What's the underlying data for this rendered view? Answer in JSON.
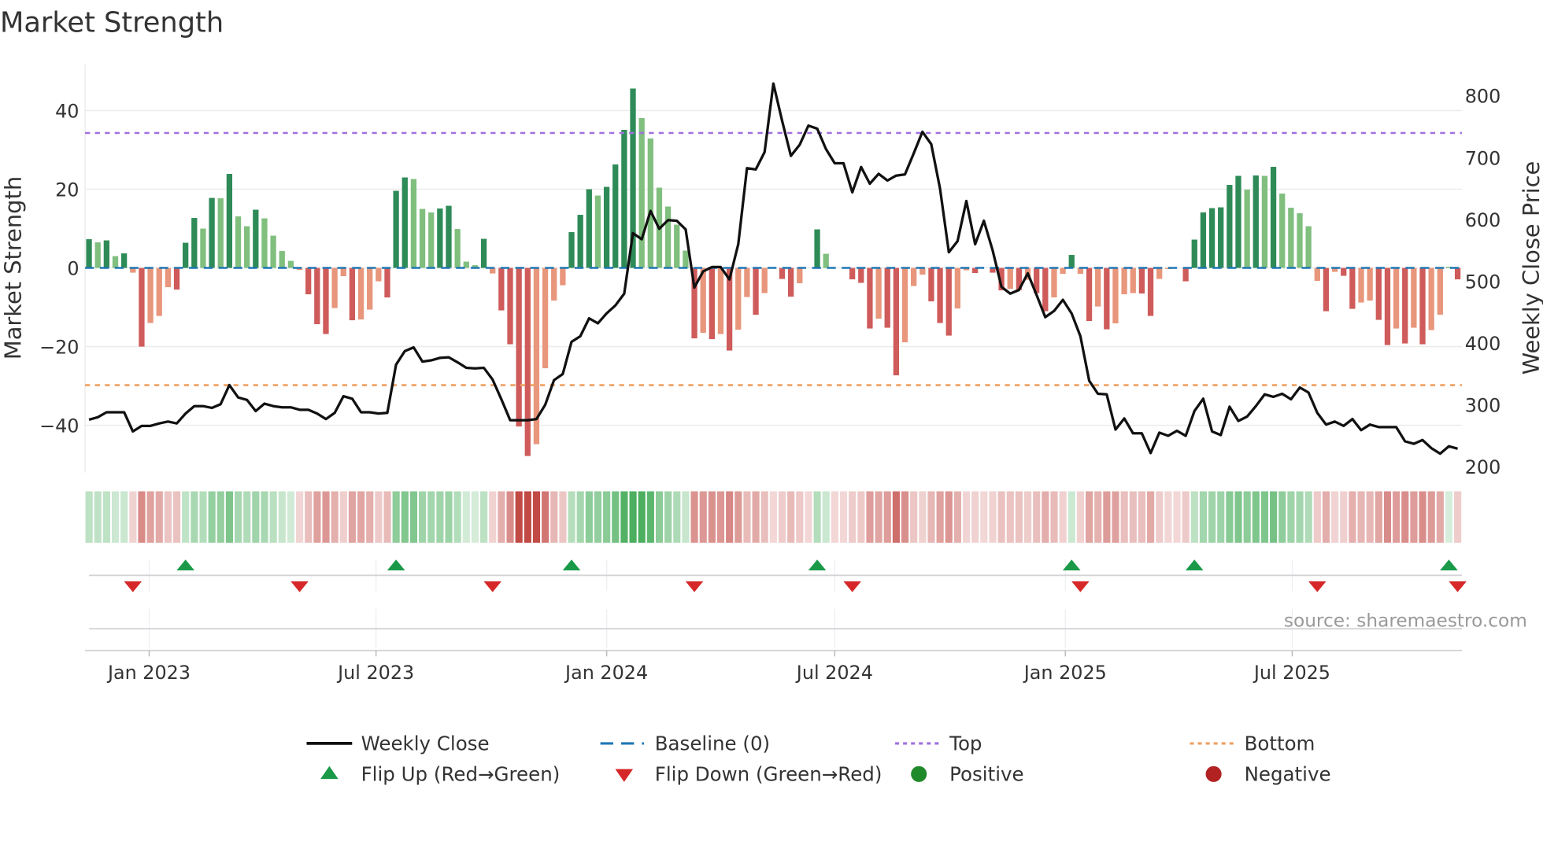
{
  "chart_data": {
    "type": "bar",
    "title": "Market Strength",
    "ylabel": "Market Strength",
    "y2label": "Weekly Close Price",
    "ylim": [
      -52,
      52
    ],
    "y2lim": [
      182,
      850
    ],
    "yticks": [
      40,
      20,
      0,
      -20,
      -40
    ],
    "ytick_labels": [
      "40",
      "20",
      "0",
      "−20",
      "−40"
    ],
    "y2ticks": [
      800,
      700,
      600,
      500,
      400,
      300,
      200
    ],
    "y2tick_labels": [
      "800",
      "700",
      "600",
      "500",
      "400",
      "300",
      "200"
    ],
    "x_start_week": "2022-11-14",
    "x_frequency": "weekly",
    "xticks": [
      {
        "date": "2023-01-01",
        "label": "Jan 2023"
      },
      {
        "date": "2023-07-01",
        "label": "Jul 2023"
      },
      {
        "date": "2024-01-01",
        "label": "Jan 2024"
      },
      {
        "date": "2024-07-01",
        "label": "Jul 2024"
      },
      {
        "date": "2025-01-01",
        "label": "Jan 2025"
      },
      {
        "date": "2025-07-01",
        "label": "Jul 2025"
      }
    ],
    "top_level": 34.3,
    "bottom_level": -29.8,
    "baseline": 0,
    "strength": [
      7.3,
      6.5,
      7.0,
      3.0,
      3.7,
      -1.2,
      -20,
      -14,
      -12.2,
      -4.9,
      -5.5,
      6.4,
      12.7,
      10,
      17.8,
      17.7,
      23.9,
      13.1,
      10.6,
      14.8,
      12.6,
      8.2,
      4.3,
      1.8,
      -0.5,
      -6.7,
      -14.3,
      -16.8,
      -10.2,
      -2.1,
      -13.3,
      -13.1,
      -10.6,
      -3.4,
      -7.5,
      19.6,
      23,
      22.6,
      15,
      14.1,
      15.1,
      15.8,
      9.9,
      1.6,
      0.7,
      7.4,
      -1.4,
      -10.8,
      -19.4,
      -40.3,
      -47.8,
      -44.8,
      -25.5,
      -8.3,
      -4.4,
      9.1,
      13.5,
      20,
      18.4,
      20.6,
      26.3,
      35.1,
      45.6,
      38.1,
      32.9,
      20.4,
      15.6,
      11,
      4.4,
      -17.9,
      -16.5,
      -18.1,
      -16.8,
      -21,
      -15.7,
      -7.4,
      -11.9,
      -6.4,
      0,
      -2.8,
      -7.3,
      -3.9,
      0,
      9.8,
      3.6,
      0,
      0,
      -2.9,
      -3.8,
      -15.4,
      -12.9,
      -15.2,
      -27.3,
      -18.9,
      -4.6,
      -1.7,
      -8.5,
      -14,
      -17.2,
      -10.3,
      -0.6,
      -1.3,
      0,
      -1.2,
      -5.7,
      -5.3,
      -5.6,
      -3,
      -6.4,
      -11,
      -7.5,
      -1.5,
      3.3,
      -1.5,
      -13.5,
      -9.8,
      -15.6,
      -14.1,
      -6.7,
      -6.4,
      -6.5,
      -12.2,
      -2.8,
      -0.3,
      0,
      -3.4,
      7.2,
      14.1,
      15.2,
      15.4,
      21.1,
      23.4,
      19.9,
      23.5,
      23.4,
      25.7,
      18.9,
      15.3,
      13.9,
      10.6,
      -3.3,
      -11,
      -1,
      -2,
      -10.4,
      -8.8,
      -8.3,
      -13.2,
      -19.6,
      -15.4,
      -19.2,
      -15.2,
      -19.4,
      -15.8,
      -11.9,
      0.3,
      -2.9
    ],
    "weekly_close": [
      276,
      280,
      288,
      288,
      288,
      257,
      266,
      266,
      270,
      273,
      270,
      286,
      298,
      298,
      295,
      301,
      332,
      312,
      308,
      290,
      302,
      298,
      296,
      296,
      292,
      292,
      286,
      277,
      287,
      314,
      310,
      288,
      288,
      286,
      287,
      365,
      387,
      393,
      370,
      372,
      376,
      377,
      369,
      360,
      359,
      360,
      341,
      309,
      275,
      275,
      275,
      277,
      300,
      340,
      350,
      402,
      411,
      440,
      432,
      448,
      461,
      480,
      578,
      568,
      614,
      585,
      599,
      598,
      584,
      490,
      516,
      523,
      523,
      503,
      560,
      683,
      681,
      709,
      820,
      760,
      703,
      721,
      752,
      747,
      714,
      691,
      691,
      644,
      685,
      658,
      674,
      663,
      671,
      673,
      707,
      742,
      722,
      650,
      547,
      565,
      630,
      560,
      598,
      550,
      491,
      480,
      486,
      513,
      478,
      442,
      452,
      470,
      448,
      411,
      339,
      318,
      317,
      260,
      278,
      254,
      254,
      222,
      255,
      250,
      258,
      250,
      290,
      310,
      257,
      251,
      297,
      274,
      281,
      298,
      317,
      313,
      318,
      309,
      328,
      320,
      287,
      268,
      273,
      266,
      277,
      259,
      268,
      264,
      264,
      264,
      241,
      237,
      243,
      230,
      221,
      233,
      229
    ],
    "flip_up_weeks": [
      11,
      35,
      55,
      83,
      112,
      126,
      155
    ],
    "flip_down_weeks": [
      5,
      24,
      46,
      69,
      87,
      113,
      140,
      156
    ],
    "legend": {
      "placement": "bottom",
      "items": [
        {
          "label": "Weekly Close",
          "kind": "line"
        },
        {
          "label": "Baseline (0)",
          "kind": "dash"
        },
        {
          "label": "Top",
          "kind": "dot-purple"
        },
        {
          "label": "Bottom",
          "kind": "dot-orange"
        },
        {
          "label": "Flip Up (Red→Green)",
          "kind": "tri-up"
        },
        {
          "label": "Flip Down (Green→Red)",
          "kind": "tri-down"
        },
        {
          "label": "Positive",
          "kind": "circle-green"
        },
        {
          "label": "Negative",
          "kind": "circle-red"
        }
      ]
    },
    "source": "source: sharemaestro.com"
  },
  "colors": {
    "pos_strong": "#2e8b57",
    "pos_weak": "#80bf7e",
    "neg_strong": "#cf5b5b",
    "neg_weak": "#e8967c",
    "baseline": "#1f77b4",
    "top": "#a070e0",
    "bottom": "#f0a060",
    "line": "#111111",
    "flip_up": "#1a9a48",
    "flip_down": "#d62828",
    "positive": "#1f8a2a",
    "negative": "#b22222",
    "heat_pos": "#4caf5f",
    "heat_neg": "#c24a45"
  }
}
